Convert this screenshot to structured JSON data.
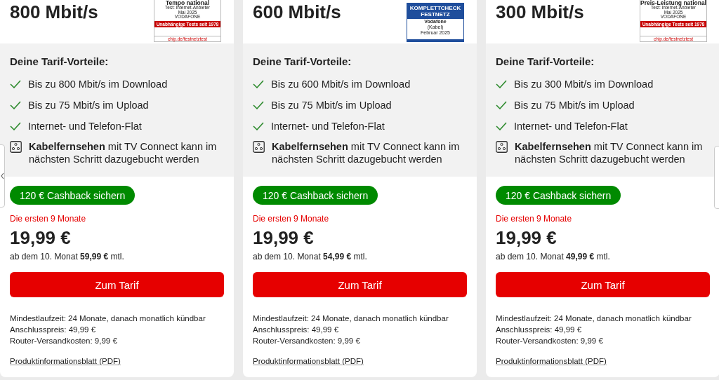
{
  "cards": [
    {
      "speed": "800 Mbit/s",
      "badge": {
        "kind": "chip",
        "title": "Tempo national",
        "lines": [
          "Test: Internet-Anbieter",
          "Mai 2025",
          "VODAFONE"
        ],
        "banner": "Unabhängige Tests seit 1978",
        "footer": "chip.de/festnetztest"
      },
      "benefits_title": "Deine Tarif-Vorteile:",
      "benefits": [
        "Bis zu 800 Mbit/s im Download",
        "Bis zu 75 Mbit/s im Upload",
        "Internet- und Telefon-Flat"
      ],
      "tv_note": "**Kabelfernsehen** mit TV Connect kann im nächsten Schritt dazugebucht werden",
      "cashback": "120 € Cashback sichern",
      "promo_period": "Die ersten 9 Monate",
      "price": "19,99 €",
      "later_price": "ab dem 10. Monat **59,99 €** mtl.",
      "button": "Zum Tarif",
      "details": [
        "Mindestlaufzeit: 24 Monate, danach monatlich kündbar",
        "Anschlusspreis: 49,99 €",
        "Router-Versandkosten: 9,99 €"
      ],
      "link": "Produktinformationsblatt (PDF)"
    },
    {
      "speed": "600 Mbit/s",
      "badge": {
        "kind": "connect",
        "title": "KOMPLETTCHECK FESTNETZ",
        "lines": [
          "Vodafone",
          "(Kabel)",
          "Februar 2025"
        ]
      },
      "benefits_title": "Deine Tarif-Vorteile:",
      "benefits": [
        "Bis zu 600 Mbit/s im Download",
        "Bis zu 75 Mbit/s im Upload",
        "Internet- und Telefon-Flat"
      ],
      "tv_note": "**Kabelfernsehen** mit TV Connect kann im nächsten Schritt dazugebucht werden",
      "cashback": "120 € Cashback sichern",
      "promo_period": "Die ersten 9 Monate",
      "price": "19,99 €",
      "later_price": "ab dem 10. Monat **54,99 €** mtl.",
      "button": "Zum Tarif",
      "details": [
        "Mindestlaufzeit: 24 Monate, danach monatlich kündbar",
        "Anschlusspreis: 49,99 €",
        "Router-Versandkosten: 9,99 €"
      ],
      "link": "Produktinformationsblatt (PDF)"
    },
    {
      "speed": "300 Mbit/s",
      "badge": {
        "kind": "chip",
        "title": "Preis-Leistung national",
        "lines": [
          "Test: Internet-Anbieter",
          "Mai 2025",
          "VODAFONE"
        ],
        "banner": "Unabhängige Tests seit 1978",
        "footer": "chip.de/festnetztest"
      },
      "benefits_title": "Deine Tarif-Vorteile:",
      "benefits": [
        "Bis zu 300 Mbit/s im Download",
        "Bis zu 75 Mbit/s im Upload",
        "Internet- und Telefon-Flat"
      ],
      "tv_note": "**Kabelfernsehen** mit TV Connect kann im nächsten Schritt dazugebucht werden",
      "cashback": "120 € Cashback sichern",
      "promo_period": "Die ersten 9 Monate",
      "price": "19,99 €",
      "later_price": "ab dem 10. Monat **49,99 €** mtl.",
      "button": "Zum Tarif",
      "details": [
        "Mindestlaufzeit: 24 Monate, danach monatlich kündbar",
        "Anschlusspreis: 49,99 €",
        "Router-Versandkosten: 9,99 €"
      ],
      "link": "Produktinformationsblatt (PDF)"
    }
  ]
}
